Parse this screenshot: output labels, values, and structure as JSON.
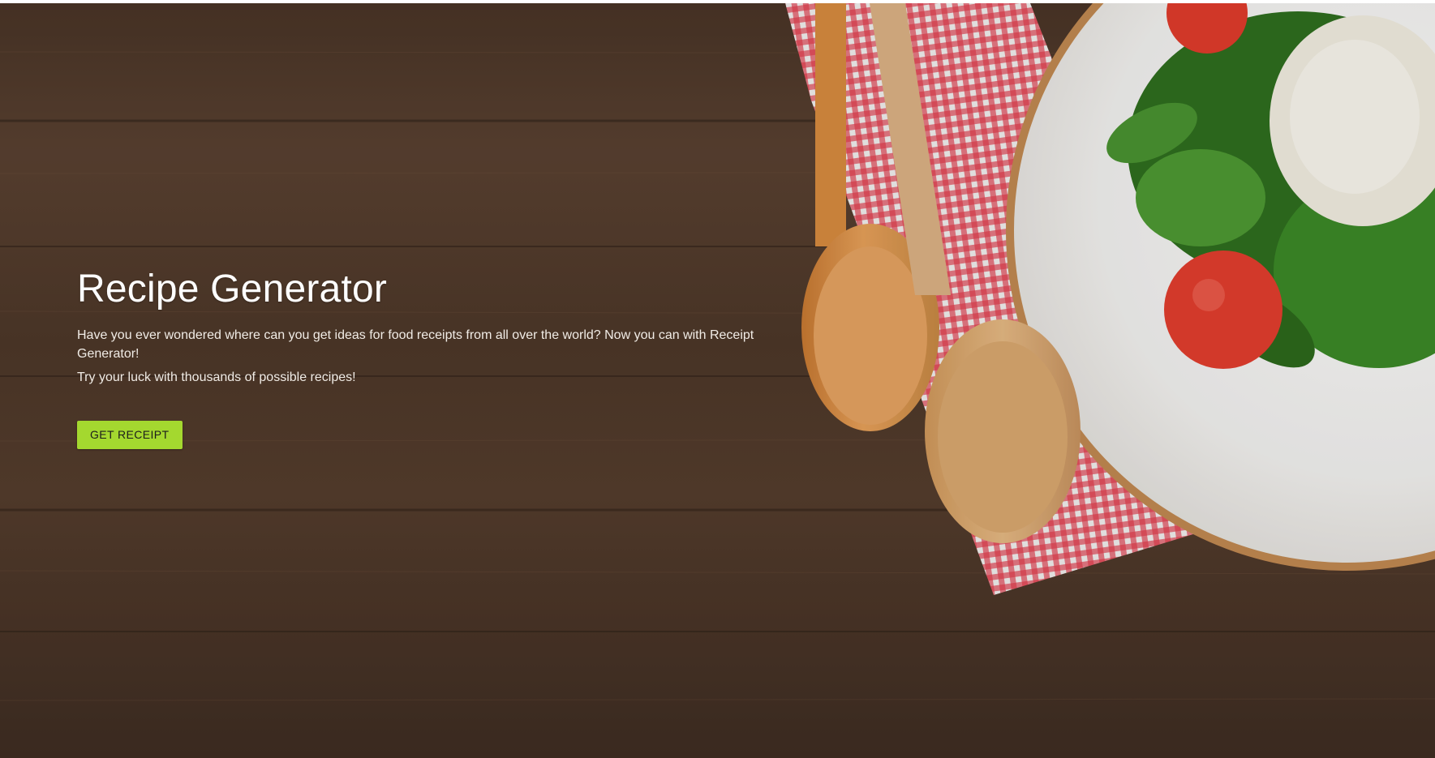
{
  "hero": {
    "title": "Recipe Generator",
    "description": "Have you ever wondered where can you get ideas for food receipts from all over the world? Now you can with Receipt Generator!",
    "tagline": "Try your luck with thousands of possible recipes!",
    "button_label": "GET RECEIPT"
  },
  "colors": {
    "button_background": "#a4d82f",
    "title_text": "#ffffff",
    "wood_background": "#4e3829"
  },
  "background_image_description_icons": {
    "spoons": "wooden-spoons-icon",
    "napkin": "checkered-napkin-icon",
    "plate": "salad-plate-icon"
  }
}
